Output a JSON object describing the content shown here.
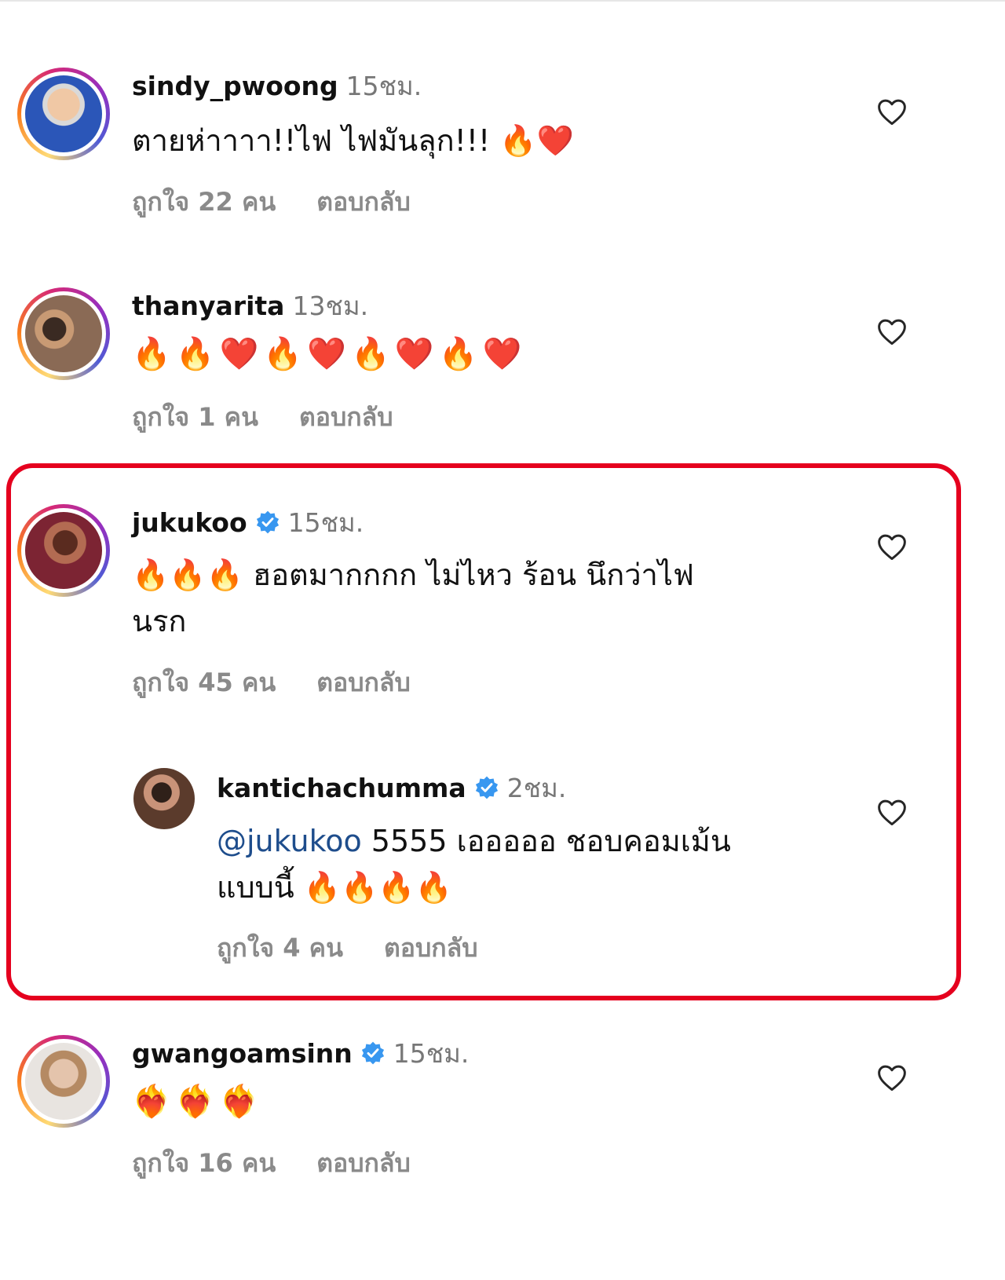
{
  "comments": [
    {
      "username": "sindy_pwoong",
      "time": "15ชม.",
      "text": "ตายห่าาาา!!ไฟ ไฟมันลุก!!! 🔥❤️",
      "likes": "ถูกใจ 22 คน",
      "reply": "ตอบกลับ"
    },
    {
      "username": "thanyarita",
      "time": "13ชม.",
      "text": "🔥🔥❤️🔥❤️🔥❤️🔥❤️",
      "likes": "ถูกใจ 1 คน",
      "reply": "ตอบกลับ"
    },
    {
      "username": "jukukoo",
      "time": "15ชม.",
      "text_line1": "🔥🔥🔥 ฮอตมากกกก ไม่ไหว ร้อน นึกว่าไฟ",
      "text_line2": "นรก",
      "likes": "ถูกใจ 45 คน",
      "reply": "ตอบกลับ"
    },
    {
      "username": "kantichachumma",
      "time": "2ชม.",
      "mention": "@jukukoo",
      "text_line1": " 5555 เอออออ ชอบคอมเม้น",
      "text_line2": "แบบนี้ 🔥🔥🔥🔥",
      "likes": "ถูกใจ 4 คน",
      "reply": "ตอบกลับ"
    },
    {
      "username": "gwangoamsinn",
      "time": "15ชม.",
      "text": "❤️‍🔥❤️‍🔥❤️‍🔥",
      "likes": "ถูกใจ 16 คน",
      "reply": "ตอบกลับ"
    }
  ],
  "icons": {
    "like": "heart-outline-icon",
    "verified": "verified-badge-icon"
  },
  "colors": {
    "highlight_border": "#e5001e",
    "verified": "#3897f0",
    "mention": "#1e4d8c",
    "meta": "#8a8a8a"
  }
}
